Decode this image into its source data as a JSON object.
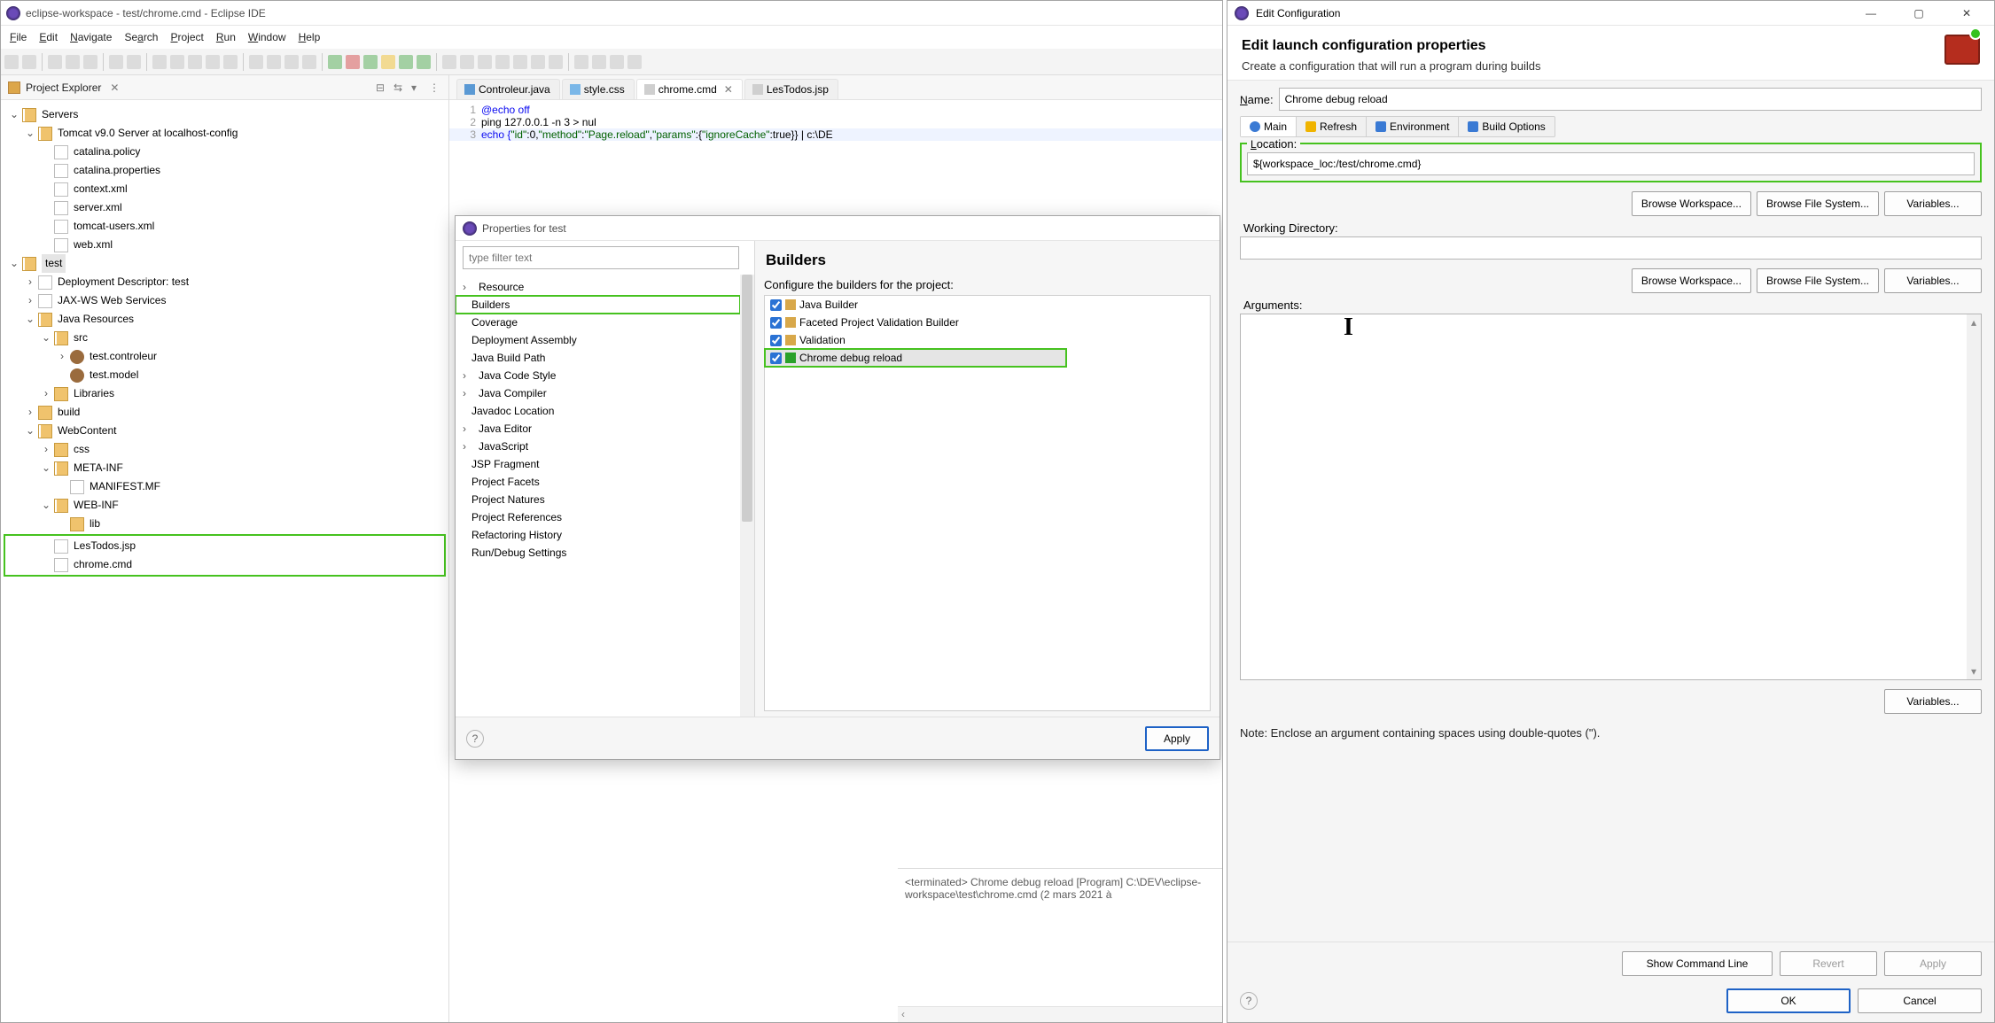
{
  "eclipse": {
    "title": "eclipse-workspace - test/chrome.cmd - Eclipse IDE",
    "menu": {
      "file": "File",
      "edit": "Edit",
      "navigate": "Navigate",
      "search": "Search",
      "project": "Project",
      "run": "Run",
      "window": "Window",
      "help": "Help"
    },
    "projectExplorer": {
      "title": "Project Explorer",
      "tree": {
        "servers": "Servers",
        "tomcat": "Tomcat v9.0 Server at localhost-config",
        "catalina_policy": "catalina.policy",
        "catalina_properties": "catalina.properties",
        "context_xml": "context.xml",
        "server_xml": "server.xml",
        "tomcat_users_xml": "tomcat-users.xml",
        "web_xml": "web.xml",
        "test": "test",
        "deployment_descriptor": "Deployment Descriptor: test",
        "jaxws": "JAX-WS Web Services",
        "java_resources": "Java Resources",
        "src": "src",
        "test_controleur": "test.controleur",
        "test_model": "test.model",
        "libraries": "Libraries",
        "build": "build",
        "webcontent": "WebContent",
        "css": "css",
        "meta_inf": "META-INF",
        "manifest": "MANIFEST.MF",
        "web_inf": "WEB-INF",
        "lib": "lib",
        "lestodos_jsp": "LesTodos.jsp",
        "chrome_cmd": "chrome.cmd"
      }
    },
    "editorTabs": {
      "controleur": "Controleur.java",
      "style": "style.css",
      "chrome": "chrome.cmd",
      "lestodos": "LesTodos.jsp"
    },
    "editor": {
      "l1": "@echo off",
      "l2": "ping 127.0.0.1 -n 3 > nul",
      "l3a": "echo {",
      "l3b": "\"id\"",
      "l3c": ":0,",
      "l3d": "\"method\"",
      "l3e": ":",
      "l3f": "\"Page.reload\"",
      "l3g": ",",
      "l3h": "\"params\"",
      "l3i": ":{",
      "l3j": "\"ignoreCache\"",
      "l3k": ":true}} | c:\\DE"
    },
    "properties": {
      "title": "Properties for test",
      "filter_placeholder": "type filter text",
      "nav": [
        "Resource",
        "Builders",
        "Coverage",
        "Deployment Assembly",
        "Java Build Path",
        "Java Code Style",
        "Java Compiler",
        "Javadoc Location",
        "Java Editor",
        "JavaScript",
        "JSP Fragment",
        "Project Facets",
        "Project Natures",
        "Project References",
        "Refactoring History",
        "Run/Debug Settings"
      ],
      "content": {
        "heading": "Builders",
        "subtitle": "Configure the builders for the project:",
        "builders": [
          "Java Builder",
          "Faceted Project Validation Builder",
          "Validation",
          "Chrome debug reload"
        ],
        "apply_btn": "Apply"
      }
    },
    "console": "<terminated> Chrome debug reload [Program] C:\\DEV\\eclipse-workspace\\test\\chrome.cmd (2 mars 2021 à"
  },
  "cfg": {
    "title": "Edit Configuration",
    "header_h1": "Edit launch configuration properties",
    "header_sub": "Create a configuration that will run a program during builds",
    "name_label": "Name:",
    "name_value": "Chrome debug reload",
    "tabs": {
      "main": "Main",
      "refresh": "Refresh",
      "environment": "Environment",
      "build": "Build Options"
    },
    "location_label": "Location:",
    "location_value": "${workspace_loc:/test/chrome.cmd}",
    "working_dir_label": "Working Directory:",
    "working_dir_value": "",
    "arguments_label": "Arguments:",
    "arguments_value": "",
    "note": "Note: Enclose an argument containing spaces using double-quotes (\").",
    "btns": {
      "browse_workspace": "Browse Workspace...",
      "browse_fs": "Browse File System...",
      "variables": "Variables...",
      "show_cmd": "Show Command Line",
      "revert": "Revert",
      "apply": "Apply",
      "ok": "OK",
      "cancel": "Cancel"
    }
  }
}
